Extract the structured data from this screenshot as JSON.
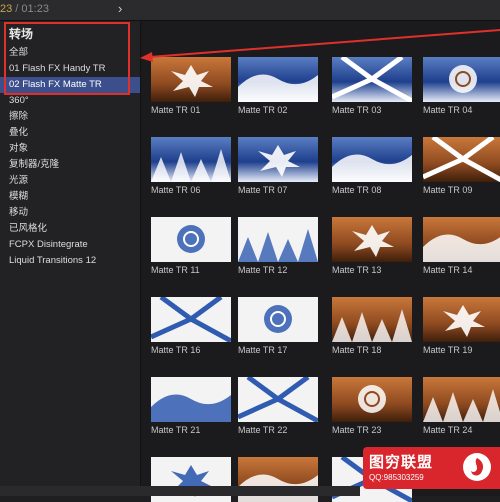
{
  "topbar": {
    "current_time": "23",
    "separator": " / ",
    "duration": "01:23",
    "collapse_icon": "chevron-right-icon"
  },
  "sidebar": {
    "title": "转场",
    "items": [
      {
        "label": "全部",
        "selected": false
      },
      {
        "label": "01 Flash FX Handy TR",
        "selected": false
      },
      {
        "label": "02 Flash FX Matte TR",
        "selected": true
      },
      {
        "label": "360°",
        "selected": false
      },
      {
        "label": "擦除",
        "selected": false
      },
      {
        "label": "叠化",
        "selected": false
      },
      {
        "label": "对象",
        "selected": false
      },
      {
        "label": "复制器/克隆",
        "selected": false
      },
      {
        "label": "光源",
        "selected": false
      },
      {
        "label": "模糊",
        "selected": false
      },
      {
        "label": "移动",
        "selected": false
      },
      {
        "label": "已风格化",
        "selected": false
      },
      {
        "label": "FCPX Disintegrate",
        "selected": false
      },
      {
        "label": "Liquid Transitions 12",
        "selected": false
      }
    ]
  },
  "browser": {
    "tiles": [
      {
        "label": "Matte TR 01",
        "style": "brown"
      },
      {
        "label": "Matte TR 02",
        "style": "blue"
      },
      {
        "label": "Matte TR 03",
        "style": "blue"
      },
      {
        "label": "Matte TR 04",
        "style": "blue"
      },
      {
        "label": "Matte TR 06",
        "style": "blue"
      },
      {
        "label": "Matte TR 07",
        "style": "blue"
      },
      {
        "label": "Matte TR 08",
        "style": "blue"
      },
      {
        "label": "Matte TR 09",
        "style": "brown"
      },
      {
        "label": "Matte TR 11",
        "style": "white"
      },
      {
        "label": "Matte TR 12",
        "style": "white"
      },
      {
        "label": "Matte TR 13",
        "style": "brown"
      },
      {
        "label": "Matte TR 14",
        "style": "brown"
      },
      {
        "label": "Matte TR 16",
        "style": "white"
      },
      {
        "label": "Matte TR 17",
        "style": "white"
      },
      {
        "label": "Matte TR 18",
        "style": "brown"
      },
      {
        "label": "Matte TR 19",
        "style": "brown"
      },
      {
        "label": "Matte TR 21",
        "style": "white"
      },
      {
        "label": "Matte TR 22",
        "style": "white"
      },
      {
        "label": "Matte TR 23",
        "style": "brown"
      },
      {
        "label": "Matte TR 24",
        "style": "brown"
      },
      {
        "label": "",
        "style": "white"
      },
      {
        "label": "",
        "style": "brown"
      },
      {
        "label": "",
        "style": "white"
      }
    ]
  },
  "watermark": {
    "title": "图穷联盟",
    "qq": "QQ:985303259"
  },
  "colors": {
    "accent": "#3c4f8c",
    "highlight_red": "#e0302a",
    "timecode": "#c9a64e"
  }
}
